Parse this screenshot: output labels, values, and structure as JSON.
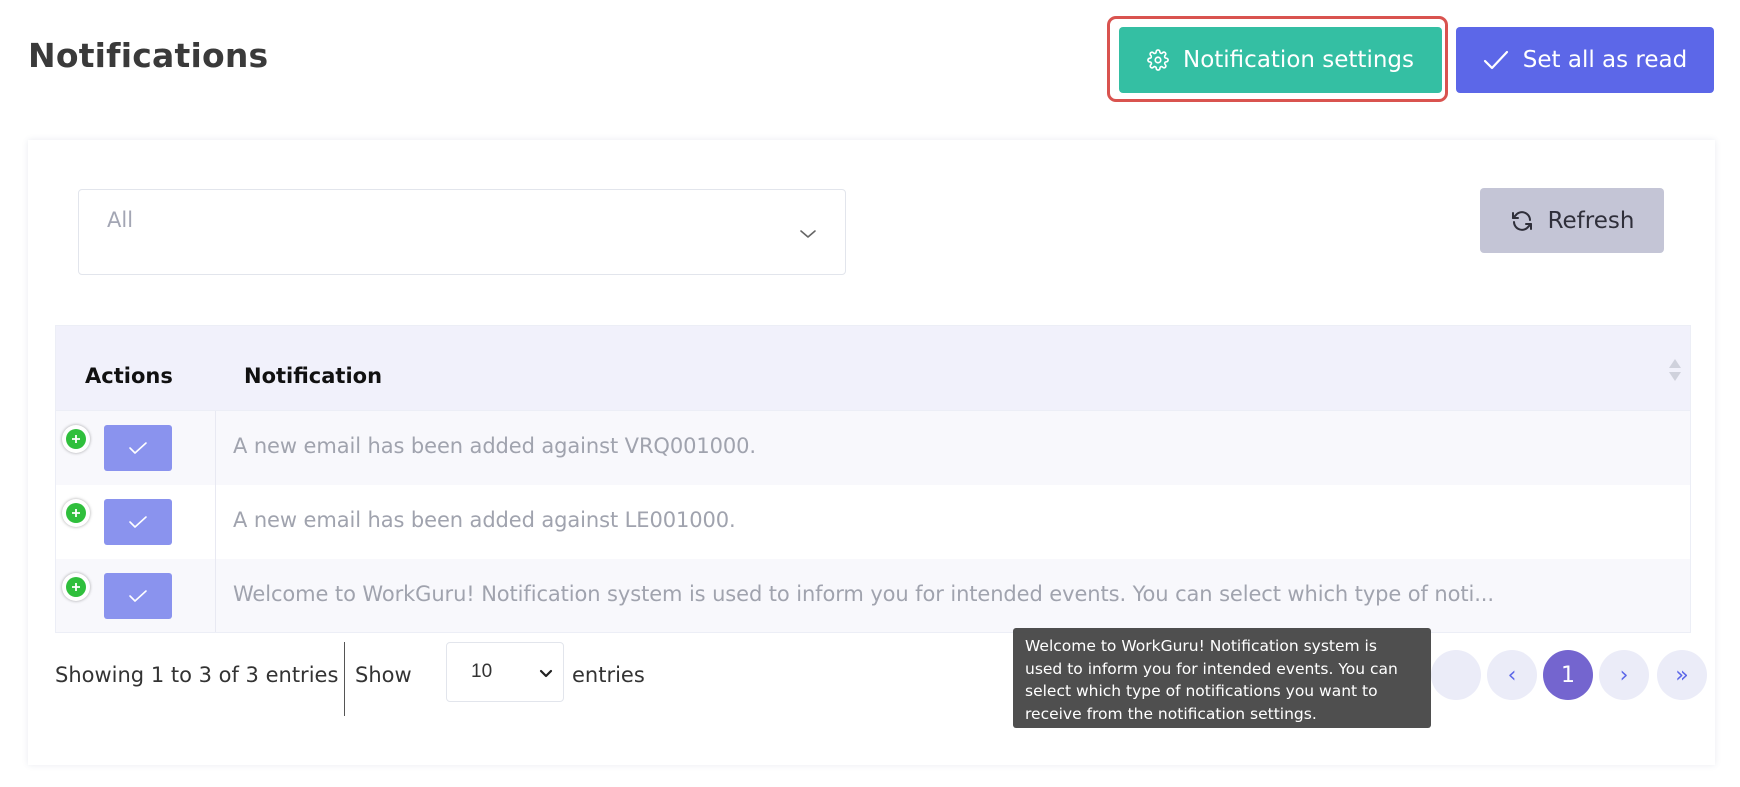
{
  "page": {
    "title": "Notifications"
  },
  "header": {
    "settings_label": "Notification settings",
    "read_all_label": "Set all as read"
  },
  "filter": {
    "value": "All"
  },
  "toolbar": {
    "refresh_label": "Refresh"
  },
  "table": {
    "columns": [
      "Actions",
      "Notification"
    ],
    "rows": [
      {
        "text": "A new email has been added against VRQ001000."
      },
      {
        "text": "A new email has been added against LE001000."
      },
      {
        "text": "Welcome to WorkGuru! Notification system is used to inform you for intended events. You can select which type of noti..."
      }
    ]
  },
  "footer": {
    "showing": "Showing 1 to 3 of 3 entries",
    "show_label": "Show",
    "page_size": "10",
    "entries_label": "entries"
  },
  "pagination": {
    "prev": "‹",
    "current": "1",
    "next": "›",
    "last": "»"
  },
  "tooltip": {
    "lines": [
      "Welcome to WorkGuru! Notification system is",
      "used to inform you for intended events. You can",
      "select which type of notifications you want to",
      "receive from the notification settings."
    ]
  },
  "icons": {
    "settings": "gear-icon",
    "read_all": "check-icon",
    "refresh": "refresh-icon",
    "expand": "plus-circle-icon",
    "mark_read": "check-icon"
  },
  "colors": {
    "settings_button": "#34bfa3",
    "read_all_button": "#5c67e8",
    "highlight": "#d9534f",
    "refresh_button": "#c4c5d6",
    "active_page": "#7465cf"
  }
}
